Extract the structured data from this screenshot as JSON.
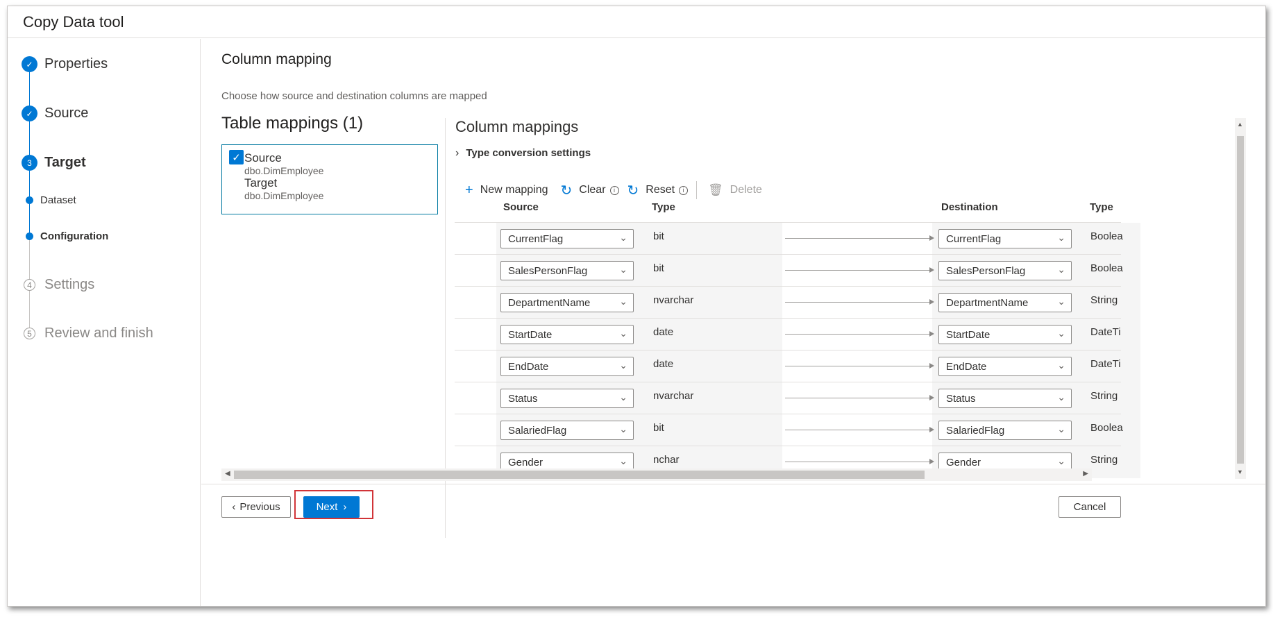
{
  "window": {
    "title": "Copy Data tool"
  },
  "steps": [
    {
      "label": "Properties",
      "state": "done",
      "marker": "✓"
    },
    {
      "label": "Source",
      "state": "done",
      "marker": "✓"
    },
    {
      "label": "Target",
      "state": "current",
      "marker": "3"
    },
    {
      "label": "Dataset",
      "state": "sub"
    },
    {
      "label": "Configuration",
      "state": "sub-current"
    },
    {
      "label": "Settings",
      "state": "todo",
      "marker": "4"
    },
    {
      "label": "Review and finish",
      "state": "todo",
      "marker": "5"
    }
  ],
  "main": {
    "title": "Column mapping",
    "description": "Choose how source and destination columns are mapped",
    "table_mappings": {
      "title": "Table mappings (1)",
      "item": {
        "source_label": "Source",
        "source_value": "dbo.DimEmployee",
        "target_label": "Target",
        "target_value": "dbo.DimEmployee"
      }
    },
    "column_mappings": {
      "title": "Column mappings",
      "type_conversion": "Type conversion settings",
      "toolbar": {
        "new_mapping": "New mapping",
        "clear": "Clear",
        "reset": "Reset",
        "delete": "Delete"
      },
      "headers": {
        "source": "Source",
        "type": "Type",
        "destination": "Destination",
        "dest_type": "Type"
      },
      "rows": [
        {
          "source": "CurrentFlag",
          "type": "bit",
          "destination": "CurrentFlag",
          "dest_type": "Boolea"
        },
        {
          "source": "SalesPersonFlag",
          "type": "bit",
          "destination": "SalesPersonFlag",
          "dest_type": "Boolea"
        },
        {
          "source": "DepartmentName",
          "type": "nvarchar",
          "destination": "DepartmentName",
          "dest_type": "String"
        },
        {
          "source": "StartDate",
          "type": "date",
          "destination": "StartDate",
          "dest_type": "DateTi"
        },
        {
          "source": "EndDate",
          "type": "date",
          "destination": "EndDate",
          "dest_type": "DateTi"
        },
        {
          "source": "Status",
          "type": "nvarchar",
          "destination": "Status",
          "dest_type": "String"
        },
        {
          "source": "SalariedFlag",
          "type": "bit",
          "destination": "SalariedFlag",
          "dest_type": "Boolea"
        },
        {
          "source": "Gender",
          "type": "nchar",
          "destination": "Gender",
          "dest_type": "String"
        }
      ]
    }
  },
  "footer": {
    "previous": "Previous",
    "next": "Next",
    "cancel": "Cancel"
  },
  "colors": {
    "accent": "#0078d4",
    "highlight": "#d13438"
  }
}
